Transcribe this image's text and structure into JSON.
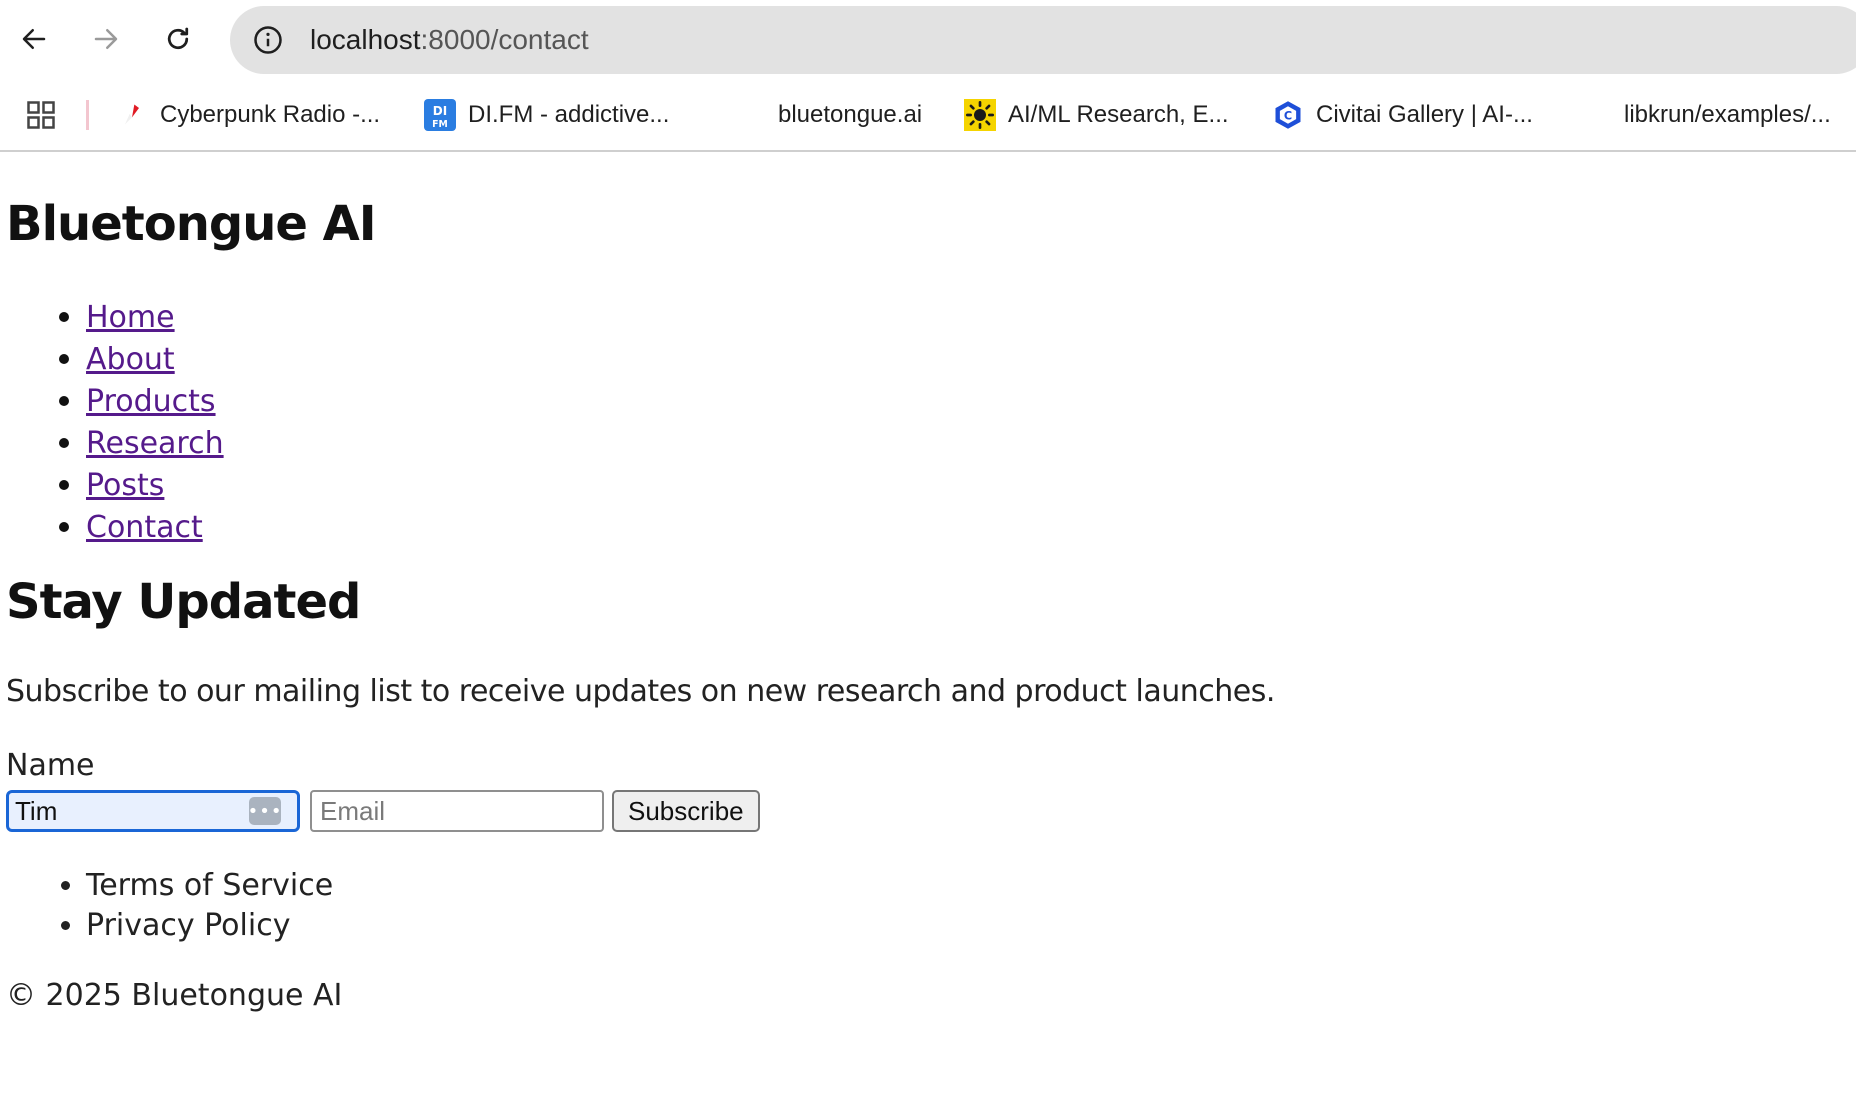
{
  "browser": {
    "url_host": "localhost",
    "url_path": ":8000/contact",
    "bookmarks": [
      {
        "label": "Cyberpunk Radio -...",
        "icon": "cyberpunk-radio-favicon"
      },
      {
        "label": "DI.FM - addictive...",
        "icon": "difm-favicon"
      },
      {
        "label": "bluetongue.ai",
        "icon": ""
      },
      {
        "label": "AI/ML Research, E...",
        "icon": "sun-favicon"
      },
      {
        "label": "Civitai Gallery | AI-...",
        "icon": "civitai-favicon"
      },
      {
        "label": "libkrun/examples/...",
        "icon": ""
      }
    ]
  },
  "site": {
    "title": "Bluetongue AI"
  },
  "nav": {
    "items": [
      {
        "label": "Home"
      },
      {
        "label": "About"
      },
      {
        "label": "Products"
      },
      {
        "label": "Research"
      },
      {
        "label": "Posts"
      },
      {
        "label": "Contact"
      }
    ]
  },
  "subscribe": {
    "heading": "Stay Updated",
    "description": "Subscribe to our mailing list to receive updates on new research and product launches.",
    "name_label": "Name",
    "name_value": "Tim",
    "email_placeholder": "Email",
    "button_label": "Subscribe",
    "autofill_icon_text": "•••"
  },
  "footer": {
    "links": [
      {
        "label": "Terms of Service"
      },
      {
        "label": "Privacy Policy"
      }
    ],
    "copyright": "© 2025 Bluetongue AI"
  },
  "colors": {
    "link_visited": "#551a8b",
    "focus_ring": "#1a66d6",
    "omnibox_bg": "#e2e2e2"
  }
}
